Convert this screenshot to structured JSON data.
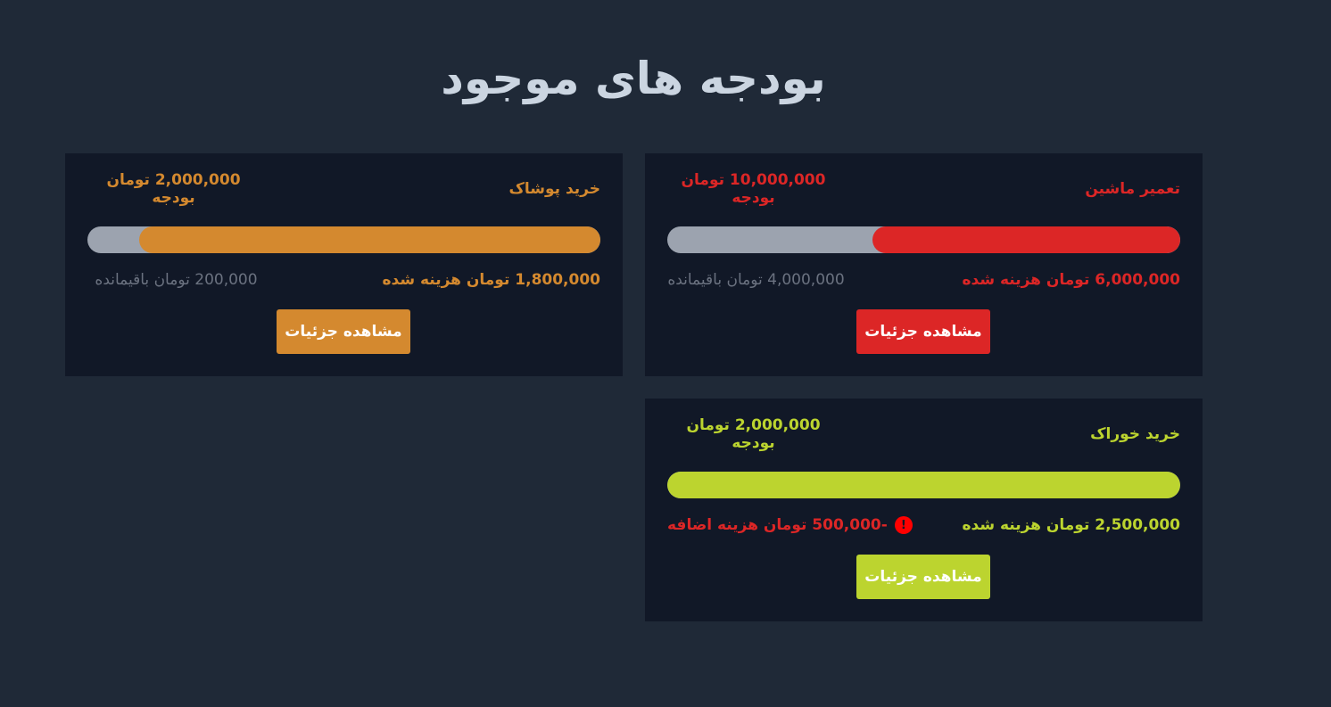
{
  "page": {
    "title": "بودجه های موجود"
  },
  "budgets": [
    {
      "name": "تعمیر ماشین",
      "budget_text": "10,000,000 تومان بودجه",
      "spent_text": "6,000,000 تومان هزینه شده",
      "remaining_text": "4,000,000 تومان باقیمانده",
      "progress_percent": 60,
      "color": "#dc2626",
      "button_label": "مشاهده جزئیات"
    },
    {
      "name": "خرید پوشاک",
      "budget_text": "2,000,000 تومان بودجه",
      "spent_text": "1,800,000 تومان هزینه شده",
      "remaining_text": "200,000 تومان باقیمانده",
      "progress_percent": 90,
      "color": "#d4892f",
      "button_label": "مشاهده جزئیات"
    },
    {
      "name": "خرید خوراک",
      "budget_text": "2,000,000 تومان بودجه",
      "spent_text": "2,500,000 تومان هزینه شده",
      "over_text": "-500,000 تومان هزینه اضافه",
      "over_icon": "alert-circle-icon",
      "over_icon_glyph": "!",
      "progress_percent": 100,
      "color": "#bcd42f",
      "button_label": "مشاهده جزئیات"
    }
  ],
  "colors": {
    "background": "#1f2937",
    "card_background": "#111827",
    "title": "#cbd5e1",
    "progress_track": "#9ca3af",
    "remaining_text": "#6b7280",
    "over_budget": "#dc2626"
  }
}
